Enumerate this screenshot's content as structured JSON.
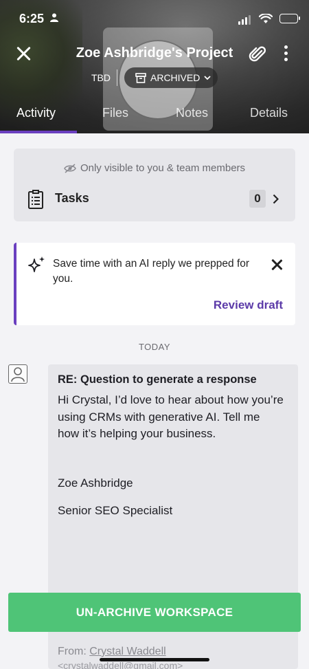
{
  "status_bar": {
    "time": "6:25"
  },
  "header": {
    "title": "Zoe Ashbridge's Project",
    "status_label": "TBD",
    "archive_label": "ARCHIVED"
  },
  "tabs": [
    {
      "label": "Activity",
      "active": true
    },
    {
      "label": "Files",
      "active": false
    },
    {
      "label": "Notes",
      "active": false
    },
    {
      "label": "Details",
      "active": false
    }
  ],
  "visibility": {
    "note": "Only visible to you & team members",
    "tasks_label": "Tasks",
    "tasks_count": "0"
  },
  "ai_suggestion": {
    "text": "Save time with an AI reply we prepped for you.",
    "action": "Review draft"
  },
  "date_divider": "TODAY",
  "message": {
    "subject": "RE: Question to generate a response",
    "body": "Hi Crystal, I’d love to hear about how you’re using CRMs with generative AI. Tell me how it’s helping your business.",
    "signature_name": "Zoe Ashbridge",
    "signature_title": "Senior SEO Specialist",
    "from_label": "From:",
    "from_name": "Crystal Waddell",
    "from_email": "<crystalwaddell@gmail.com>"
  },
  "footer": {
    "unarchive_label": "UN-ARCHIVE WORKSPACE"
  },
  "colors": {
    "accent": "#6a3fbf",
    "action_green": "#4fc477",
    "link_purple": "#5b3aa8"
  }
}
